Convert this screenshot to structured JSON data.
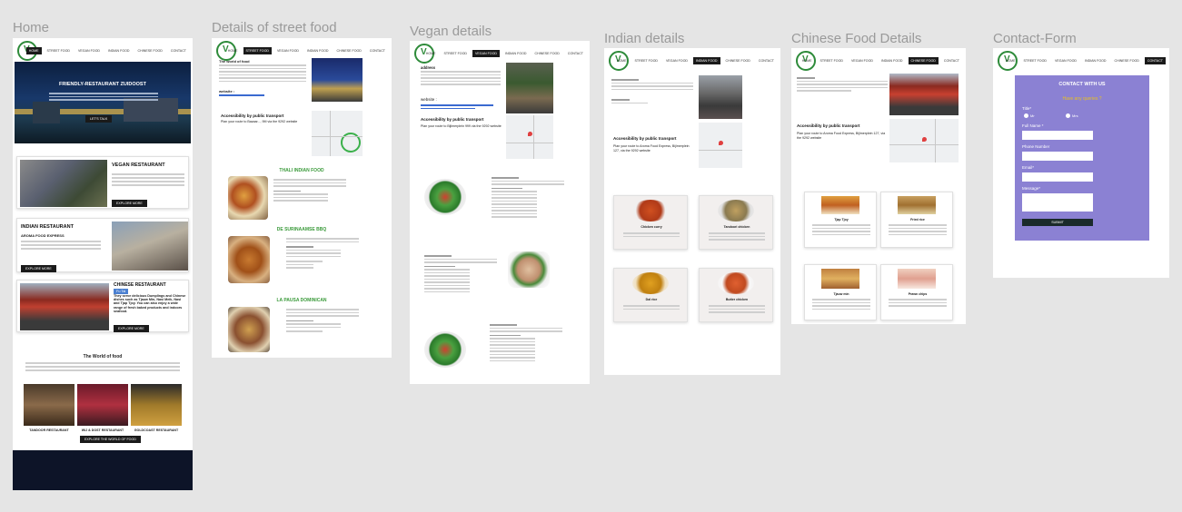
{
  "frames": {
    "home": "Home",
    "street": "Details of  street food",
    "vegan": "Vegan details",
    "indian": "Indian details",
    "chinese": "Chinese Food Details",
    "contact": "Contact-Form"
  },
  "nav": {
    "home": "HOME",
    "street": "STREET FOOD",
    "vegan": "VEGAN FOOD",
    "indian": "INDIAN FOOD",
    "chinese": "CHINESE FOOD",
    "contact": "CONTACT"
  },
  "home": {
    "hero_title": "FRIENDLY-RESTAURANT ZUIDOOST",
    "hero_button": "LET'S TALK",
    "vegan_title": "VEGAN RESTAURANT",
    "vegan_button": "EXPLORE MORE",
    "indian_title": "INDIAN RESTAURANT",
    "indian_sub": "AROMA FOOD EXPRESS",
    "indian_button": "EXPLORE MORE",
    "chinese_title": "CHINESE RESTAURANT",
    "chinese_tag": "Fu Tai",
    "chinese_body": "They serve delicious Dumplings and Chinese dishes such as Tjauw Min, Nasi Meik, Nasi and Tjap Tjoy. You can also enjoy a wide range of fresh baked products and indoors seafood.",
    "chinese_button": "EXPLORE MORE",
    "world_title": "The World of food",
    "r1": "TANDOOR RESTAURANT",
    "r2": "WIJ & DOST RESTAURANT",
    "r3": "GOLDCOAST RESTAURANT",
    "world_button": "EXPLORE THE WORLD OF FOOD"
  },
  "street": {
    "intro": "The world of food",
    "website": "website :",
    "access": "Accessibility by public transport",
    "access_sub": "Plan your route to Bazaar..., 9M via the 9292 website",
    "s1": "THALI INDIAN FOOD",
    "s2": "DE SURINAAMSE BBQ",
    "s3": "LA PAUSA DOMINICAN"
  },
  "vegan": {
    "address": "address",
    "website": "website :",
    "access": "Accessibility by public transport",
    "access_sub": "Plan your route to Bijlmerplein 999 via the 9292 website"
  },
  "indian": {
    "access": "Accessibility by public transport",
    "access_sub": "Plan your route to Aroma Food Express, Bijlmerplein 127, via the 9292 website",
    "d1": "Chicken curry",
    "d2": "Tandoori chicken",
    "d3": "Dal rice",
    "d4": "Butter chicken"
  },
  "chinese": {
    "access": "Accessibility by public transport",
    "access_sub": "Plan your route to Aroma Food Express, Bijlmerplein 127, via the 9292 website",
    "d1": "Tjap Tjoy",
    "d2": "Fried rice",
    "d3": "Tjauw min",
    "d4": "Prawn chips"
  },
  "contact": {
    "title": "CONTACT WITH US",
    "question": "Have any queries ?",
    "title_label": "Title*",
    "mr": "Mr",
    "mrs": "Mrs",
    "fullname": "Full Name *",
    "phone": "Phone Number",
    "email": "Email*",
    "message": "Message*",
    "submit": "SUBMIT"
  },
  "colors": {
    "contact_bg": "#8b81d3",
    "accent_green": "#3a9a3a",
    "nav_active": "#1a1a1a",
    "footer": "#0d1428"
  }
}
